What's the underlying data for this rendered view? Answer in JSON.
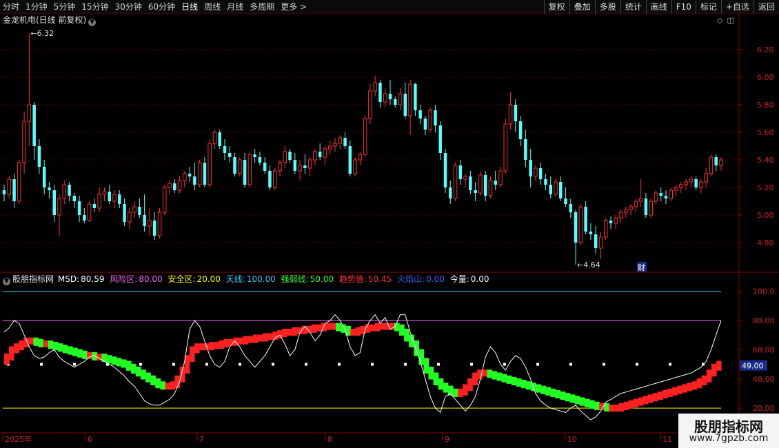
{
  "toolbar": {
    "periods": [
      "分时",
      "1分钟",
      "5分钟",
      "15分钟",
      "30分钟",
      "60分钟",
      "日线",
      "周线",
      "月线",
      "多周期",
      "更多 >"
    ],
    "active_period": "日线",
    "tools": [
      "复权",
      "叠加",
      "多股",
      "统计",
      "画线",
      "F10",
      "标记",
      "+自选",
      "返回"
    ]
  },
  "main_chart": {
    "title": "金龙机电(日线 前复权)",
    "title_icon": "chevron-down-icon",
    "y_ticks": [
      "6.20",
      "6.00",
      "5.80",
      "5.60",
      "5.40",
      "5.20",
      "5.00",
      "4.80"
    ],
    "high_label": "6.32",
    "low_label": "4.64",
    "finance_badge": "财",
    "up_color": "#ff3030",
    "down_color": "#54ffff"
  },
  "indicator": {
    "name": "股朋指标网",
    "fields": [
      {
        "label": "MSD:",
        "value": "80.59",
        "color": "#ffffff"
      },
      {
        "label": "风险区:",
        "value": "80.00",
        "color": "#ff66ff"
      },
      {
        "label": "安全区:",
        "value": "20.00",
        "color": "#ffff00"
      },
      {
        "label": "天线:",
        "value": "100.00",
        "color": "#33ccff"
      },
      {
        "label": "强弱线:",
        "value": "50.00",
        "color": "#33ff33"
      },
      {
        "label": "趋势值:",
        "value": "50.45",
        "color": "#ff3333"
      },
      {
        "label": "火焰山:",
        "value": "0.00",
        "color": "#3366ff"
      },
      {
        "label": "今量:",
        "value": "0.00",
        "color": "#ffffff"
      }
    ],
    "y_ticks": [
      "100.0",
      "80.00",
      "60.00",
      "40.00",
      "20.00"
    ],
    "current_value": "49.00"
  },
  "x_axis": {
    "labels": [
      "2025年",
      "6",
      "7",
      "8",
      "9",
      "10",
      "11"
    ]
  },
  "watermark": {
    "line1": "股朋指标网",
    "line2": "www.7gpzb.com"
  },
  "chart_data": {
    "type": "candlestick",
    "price_ylim": [
      4.6,
      6.35
    ],
    "candles": [
      [
        5.18,
        5.22,
        5.1,
        5.15
      ],
      [
        5.15,
        5.28,
        5.12,
        5.26
      ],
      [
        5.26,
        5.3,
        5.05,
        5.1
      ],
      [
        5.1,
        5.4,
        5.08,
        5.38
      ],
      [
        5.38,
        5.75,
        5.3,
        5.68
      ],
      [
        5.68,
        6.32,
        5.5,
        5.8
      ],
      [
        5.8,
        5.82,
        5.4,
        5.5
      ],
      [
        5.5,
        5.55,
        5.3,
        5.35
      ],
      [
        5.35,
        5.4,
        5.15,
        5.2
      ],
      [
        5.2,
        5.24,
        5.12,
        5.18
      ],
      [
        5.18,
        5.22,
        4.95,
        5.0
      ],
      [
        5.0,
        5.15,
        4.85,
        5.12
      ],
      [
        5.12,
        5.25,
        5.08,
        5.22
      ],
      [
        5.22,
        5.24,
        5.1,
        5.14
      ],
      [
        5.14,
        5.16,
        5.05,
        5.1
      ],
      [
        5.1,
        5.14,
        4.95,
        5.0
      ],
      [
        5.0,
        5.05,
        4.94,
        4.96
      ],
      [
        4.96,
        5.1,
        4.95,
        5.08
      ],
      [
        5.08,
        5.12,
        5.02,
        5.05
      ],
      [
        5.05,
        5.2,
        5.02,
        5.15
      ],
      [
        5.15,
        5.2,
        5.1,
        5.17
      ],
      [
        5.17,
        5.22,
        5.08,
        5.1
      ],
      [
        5.1,
        5.18,
        5.05,
        5.15
      ],
      [
        5.15,
        5.18,
        5.05,
        5.08
      ],
      [
        5.08,
        5.12,
        4.92,
        4.95
      ],
      [
        4.95,
        5.05,
        4.9,
        5.02
      ],
      [
        5.02,
        5.1,
        4.98,
        5.06
      ],
      [
        5.06,
        5.12,
        4.98,
        5.0
      ],
      [
        5.0,
        5.15,
        4.88,
        4.92
      ],
      [
        4.92,
        5.05,
        4.85,
        4.96
      ],
      [
        4.96,
        5.02,
        4.82,
        4.85
      ],
      [
        4.85,
        5.05,
        4.83,
        5.02
      ],
      [
        5.02,
        5.22,
        5.0,
        5.2
      ],
      [
        5.2,
        5.25,
        5.15,
        5.23
      ],
      [
        5.23,
        5.26,
        5.16,
        5.18
      ],
      [
        5.18,
        5.28,
        5.16,
        5.25
      ],
      [
        5.25,
        5.32,
        5.2,
        5.3
      ],
      [
        5.3,
        5.35,
        5.24,
        5.28
      ],
      [
        5.28,
        5.38,
        5.18,
        5.22
      ],
      [
        5.22,
        5.4,
        5.2,
        5.38
      ],
      [
        5.38,
        5.42,
        5.2,
        5.22
      ],
      [
        5.22,
        5.55,
        5.2,
        5.52
      ],
      [
        5.52,
        5.62,
        5.48,
        5.6
      ],
      [
        5.6,
        5.62,
        5.48,
        5.5
      ],
      [
        5.5,
        5.55,
        5.4,
        5.45
      ],
      [
        5.45,
        5.5,
        5.38,
        5.42
      ],
      [
        5.42,
        5.45,
        5.28,
        5.3
      ],
      [
        5.3,
        5.42,
        5.28,
        5.4
      ],
      [
        5.4,
        5.45,
        5.2,
        5.22
      ],
      [
        5.22,
        5.46,
        5.2,
        5.44
      ],
      [
        5.44,
        5.48,
        5.38,
        5.42
      ],
      [
        5.42,
        5.46,
        5.36,
        5.38
      ],
      [
        5.38,
        5.42,
        5.3,
        5.32
      ],
      [
        5.32,
        5.36,
        5.18,
        5.2
      ],
      [
        5.2,
        5.34,
        5.18,
        5.32
      ],
      [
        5.32,
        5.4,
        5.28,
        5.38
      ],
      [
        5.38,
        5.5,
        5.34,
        5.46
      ],
      [
        5.46,
        5.48,
        5.38,
        5.4
      ],
      [
        5.4,
        5.45,
        5.3,
        5.32
      ],
      [
        5.32,
        5.4,
        5.25,
        5.36
      ],
      [
        5.36,
        5.44,
        5.3,
        5.34
      ],
      [
        5.34,
        5.42,
        5.28,
        5.4
      ],
      [
        5.4,
        5.48,
        5.36,
        5.46
      ],
      [
        5.46,
        5.52,
        5.4,
        5.42
      ],
      [
        5.42,
        5.5,
        5.36,
        5.48
      ],
      [
        5.48,
        5.54,
        5.44,
        5.5
      ],
      [
        5.5,
        5.56,
        5.46,
        5.52
      ],
      [
        5.52,
        5.58,
        5.48,
        5.56
      ],
      [
        5.56,
        5.6,
        5.48,
        5.5
      ],
      [
        5.5,
        5.54,
        5.28,
        5.3
      ],
      [
        5.3,
        5.42,
        5.28,
        5.4
      ],
      [
        5.4,
        5.46,
        5.36,
        5.44
      ],
      [
        5.44,
        5.72,
        5.42,
        5.7
      ],
      [
        5.7,
        5.95,
        5.66,
        5.9
      ],
      [
        5.9,
        6.01,
        5.86,
        5.96
      ],
      [
        5.96,
        5.98,
        5.78,
        5.82
      ],
      [
        5.82,
        5.92,
        5.78,
        5.88
      ],
      [
        5.88,
        5.98,
        5.8,
        5.84
      ],
      [
        5.84,
        5.86,
        5.78,
        5.8
      ],
      [
        5.8,
        5.92,
        5.76,
        5.88
      ],
      [
        5.88,
        5.96,
        5.7,
        5.72
      ],
      [
        5.72,
        5.98,
        5.58,
        5.95
      ],
      [
        5.95,
        5.96,
        5.72,
        5.76
      ],
      [
        5.76,
        5.8,
        5.66,
        5.7
      ],
      [
        5.7,
        5.72,
        5.58,
        5.62
      ],
      [
        5.62,
        5.78,
        5.6,
        5.76
      ],
      [
        5.76,
        5.8,
        5.6,
        5.65
      ],
      [
        5.65,
        5.68,
        5.4,
        5.45
      ],
      [
        5.45,
        5.48,
        5.16,
        5.2
      ],
      [
        5.2,
        5.25,
        5.08,
        5.12
      ],
      [
        5.12,
        5.38,
        5.1,
        5.36
      ],
      [
        5.36,
        5.4,
        5.22,
        5.26
      ],
      [
        5.26,
        5.3,
        5.2,
        5.28
      ],
      [
        5.28,
        5.32,
        5.15,
        5.18
      ],
      [
        5.18,
        5.24,
        5.1,
        5.16
      ],
      [
        5.16,
        5.32,
        5.14,
        5.29
      ],
      [
        5.29,
        5.32,
        5.1,
        5.14
      ],
      [
        5.14,
        5.28,
        5.12,
        5.25
      ],
      [
        5.25,
        5.32,
        5.18,
        5.22
      ],
      [
        5.22,
        5.35,
        5.2,
        5.32
      ],
      [
        5.32,
        5.7,
        5.3,
        5.66
      ],
      [
        5.66,
        5.89,
        5.62,
        5.8
      ],
      [
        5.8,
        5.84,
        5.6,
        5.68
      ],
      [
        5.68,
        5.72,
        5.5,
        5.55
      ],
      [
        5.55,
        5.62,
        5.35,
        5.4
      ],
      [
        5.4,
        5.48,
        5.2,
        5.28
      ],
      [
        5.28,
        5.36,
        5.25,
        5.34
      ],
      [
        5.34,
        5.38,
        5.22,
        5.26
      ],
      [
        5.26,
        5.3,
        5.18,
        5.22
      ],
      [
        5.22,
        5.28,
        5.12,
        5.15
      ],
      [
        5.15,
        5.26,
        5.13,
        5.24
      ],
      [
        5.24,
        5.28,
        5.1,
        5.12
      ],
      [
        5.12,
        5.2,
        5.06,
        5.08
      ],
      [
        5.08,
        5.12,
        4.98,
        5.02
      ],
      [
        5.02,
        5.04,
        4.64,
        4.8
      ],
      [
        4.8,
        5.08,
        4.78,
        5.06
      ],
      [
        5.06,
        5.1,
        4.86,
        4.88
      ],
      [
        4.88,
        4.94,
        4.82,
        4.86
      ],
      [
        4.86,
        4.92,
        4.72,
        4.76
      ],
      [
        4.76,
        4.88,
        4.68,
        4.84
      ],
      [
        4.84,
        4.98,
        4.82,
        4.96
      ],
      [
        4.96,
        4.99,
        4.9,
        4.94
      ],
      [
        4.94,
        5.0,
        4.9,
        4.98
      ],
      [
        4.98,
        5.04,
        4.94,
        5.02
      ],
      [
        5.02,
        5.06,
        4.98,
        5.04
      ],
      [
        5.04,
        5.08,
        5.0,
        5.06
      ],
      [
        5.06,
        5.12,
        5.02,
        5.1
      ],
      [
        5.1,
        5.26,
        5.06,
        5.12
      ],
      [
        5.12,
        5.16,
        4.98,
        5.0
      ],
      [
        5.0,
        5.12,
        4.98,
        5.1
      ],
      [
        5.1,
        5.18,
        5.08,
        5.16
      ],
      [
        5.16,
        5.2,
        5.1,
        5.14
      ],
      [
        5.14,
        5.18,
        5.08,
        5.12
      ],
      [
        5.12,
        5.2,
        5.1,
        5.18
      ],
      [
        5.18,
        5.22,
        5.14,
        5.2
      ],
      [
        5.2,
        5.24,
        5.16,
        5.22
      ],
      [
        5.22,
        5.26,
        5.18,
        5.24
      ],
      [
        5.24,
        5.28,
        5.2,
        5.26
      ],
      [
        5.26,
        5.28,
        5.18,
        5.2
      ],
      [
        5.2,
        5.26,
        5.16,
        5.24
      ],
      [
        5.24,
        5.34,
        5.2,
        5.3
      ],
      [
        5.3,
        5.44,
        5.28,
        5.42
      ],
      [
        5.42,
        5.44,
        5.32,
        5.36
      ],
      [
        5.36,
        5.42,
        5.32,
        5.4
      ]
    ],
    "msd": [
      72,
      75,
      80,
      78,
      70,
      62,
      56,
      54,
      55,
      58,
      60,
      55,
      52,
      50,
      48,
      50,
      52,
      55,
      56,
      54,
      52,
      50,
      48,
      45,
      42,
      38,
      35,
      30,
      25,
      23,
      22,
      22,
      24,
      26,
      30,
      38,
      52,
      74,
      80,
      76,
      66,
      56,
      50,
      48,
      52,
      62,
      66,
      62,
      56,
      52,
      48,
      52,
      56,
      62,
      68,
      70,
      64,
      56,
      60,
      72,
      76,
      72,
      66,
      70,
      78,
      80,
      84,
      80,
      74,
      62,
      56,
      58,
      74,
      80,
      84,
      78,
      82,
      74,
      76,
      84,
      84,
      72,
      62,
      52,
      40,
      28,
      20,
      17,
      28,
      30,
      26,
      22,
      18,
      22,
      28,
      40,
      55,
      62,
      58,
      50,
      46,
      52,
      56,
      54,
      48,
      40,
      30,
      25,
      22,
      20,
      19,
      18,
      17,
      20,
      22,
      18,
      15,
      12,
      14,
      18,
      24,
      26,
      28,
      30,
      31,
      32,
      33,
      34,
      35,
      36,
      37,
      38,
      39,
      40,
      41,
      42,
      43,
      44,
      46,
      48,
      52,
      60,
      70,
      80
    ],
    "trend": [
      52,
      55,
      60,
      62,
      64,
      66,
      66,
      65,
      64,
      64,
      63,
      62,
      61,
      60,
      59,
      58,
      57,
      56,
      56,
      55,
      55,
      54,
      53,
      52,
      51,
      50,
      48,
      46,
      44,
      42,
      40,
      38,
      36,
      35,
      35,
      36,
      40,
      46,
      54,
      60,
      62,
      62,
      62,
      63,
      63,
      64,
      65,
      65,
      66,
      66,
      67,
      67,
      68,
      68,
      69,
      69,
      70,
      71,
      72,
      72,
      73,
      73,
      74,
      74,
      75,
      75,
      76,
      76,
      76,
      75,
      74,
      72,
      72,
      73,
      74,
      75,
      75,
      76,
      76,
      76,
      76,
      75,
      72,
      68,
      64,
      58,
      52,
      46,
      42,
      38,
      35,
      33,
      31,
      30,
      31,
      34,
      38,
      42,
      44,
      44,
      43,
      42,
      41,
      40,
      39,
      38,
      37,
      36,
      35,
      34,
      33,
      32,
      31,
      30,
      29,
      28,
      27,
      26,
      25,
      24,
      23,
      22,
      21,
      21,
      20,
      20,
      20,
      21,
      22,
      23,
      24,
      25,
      26,
      27,
      28,
      29,
      30,
      31,
      32,
      33,
      34,
      35,
      36,
      38,
      40,
      44,
      48,
      50
    ]
  }
}
